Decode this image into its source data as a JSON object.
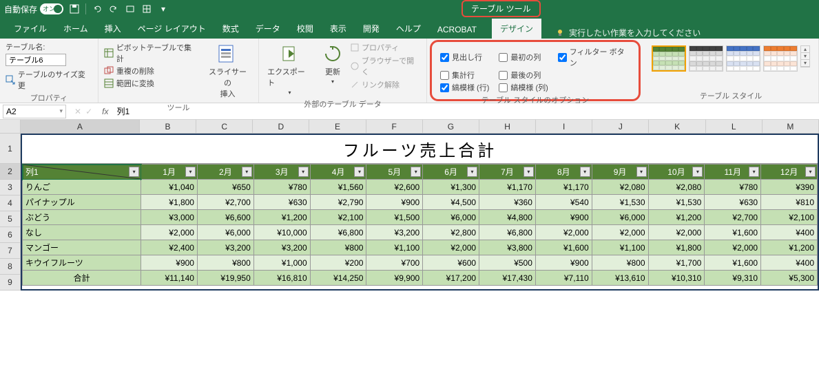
{
  "titlebar": {
    "autosave_label": "自動保存",
    "toggle_state": "オン"
  },
  "context_tab": "テーブル ツール",
  "tabs": [
    "ファイル",
    "ホーム",
    "挿入",
    "ページ レイアウト",
    "数式",
    "データ",
    "校閲",
    "表示",
    "開発",
    "ヘルプ",
    "ACROBAT",
    "デザイン"
  ],
  "active_tab": "デザイン",
  "tell_me": "実行したい作業を入力してください",
  "ribbon": {
    "properties": {
      "name_label": "テーブル名:",
      "name_value": "テーブル6",
      "resize": "テーブルのサイズ変更",
      "group_label": "プロパティ"
    },
    "tools": {
      "pivot": "ピボットテーブルで集計",
      "dedup": "重複の削除",
      "range": "範囲に変換",
      "slicer": "スライサーの\n挿入",
      "group_label": "ツール"
    },
    "external": {
      "export": "エクスポート",
      "refresh": "更新",
      "props": "プロパティ",
      "browser": "ブラウザーで開く",
      "unlink": "リンク解除",
      "group_label": "外部のテーブル データ"
    },
    "style_opts": {
      "header_row": "見出し行",
      "total_row": "集計行",
      "banded_rows": "縞模様 (行)",
      "first_col": "最初の列",
      "last_col": "最後の列",
      "banded_cols": "縞模様 (列)",
      "filter_btn": "フィルター ボタン",
      "group_label": "テーブル スタイルのオプション"
    },
    "styles_label": "テーブル スタイル"
  },
  "name_box": "A2",
  "formula": "列1",
  "columns": [
    "A",
    "B",
    "C",
    "D",
    "E",
    "F",
    "G",
    "H",
    "I",
    "J",
    "K",
    "L",
    "M"
  ],
  "sheet_title": "フルーツ売上合計",
  "headers": [
    "列1",
    "1月",
    "2月",
    "3月",
    "4月",
    "5月",
    "6月",
    "7月",
    "8月",
    "9月",
    "10月",
    "11月",
    "12月"
  ],
  "chart_data": {
    "type": "table",
    "title": "フルーツ売上合計",
    "columns": [
      "1月",
      "2月",
      "3月",
      "4月",
      "5月",
      "6月",
      "7月",
      "8月",
      "9月",
      "10月",
      "11月",
      "12月"
    ],
    "rows": [
      {
        "name": "りんご",
        "values": [
          1040,
          650,
          780,
          1560,
          2600,
          1300,
          1170,
          1170,
          2080,
          2080,
          780,
          390
        ]
      },
      {
        "name": "パイナップル",
        "values": [
          1800,
          2700,
          630,
          2790,
          900,
          4500,
          360,
          540,
          1530,
          1530,
          630,
          810
        ]
      },
      {
        "name": "ぶどう",
        "values": [
          3000,
          6600,
          1200,
          2100,
          1500,
          6000,
          4800,
          900,
          6000,
          1200,
          2700,
          2100
        ]
      },
      {
        "name": "なし",
        "values": [
          2000,
          6000,
          10000,
          6800,
          3200,
          2800,
          6800,
          2000,
          2000,
          2000,
          1600,
          400
        ]
      },
      {
        "name": "マンゴー",
        "values": [
          2400,
          3200,
          3200,
          800,
          1100,
          2000,
          3800,
          1600,
          1100,
          1800,
          2000,
          1200
        ]
      },
      {
        "name": "キウイフルーツ",
        "values": [
          900,
          800,
          1000,
          200,
          700,
          600,
          500,
          900,
          800,
          1700,
          1600,
          400
        ]
      },
      {
        "name": "合計",
        "values": [
          11140,
          19950,
          16810,
          14250,
          9900,
          17200,
          17430,
          7110,
          13610,
          10310,
          9310,
          5300
        ]
      }
    ],
    "currency_prefix": "¥"
  }
}
